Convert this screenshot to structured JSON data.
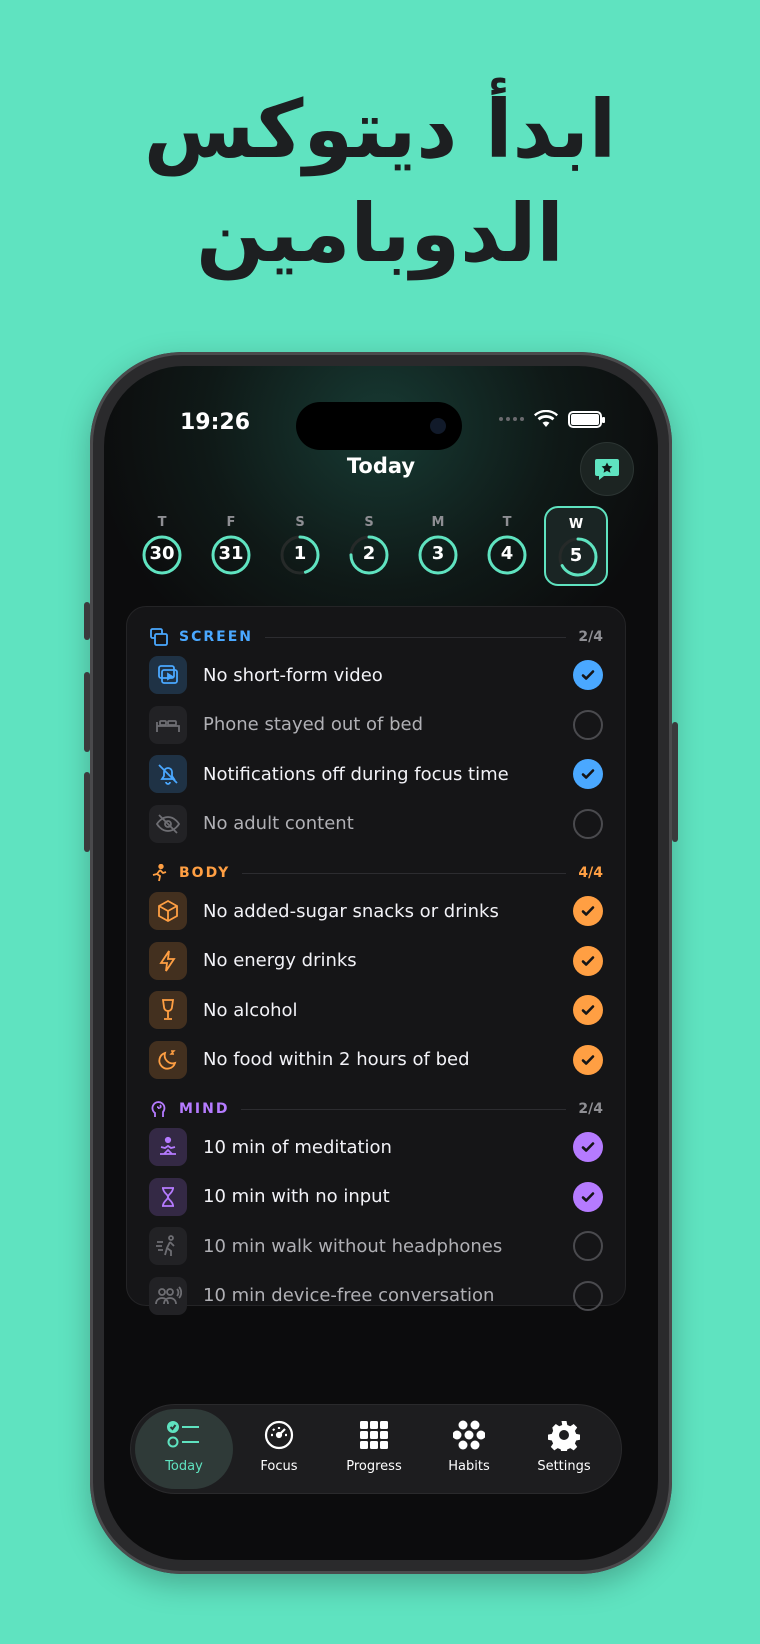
{
  "headline": {
    "line1": "ابدأ ديتوكس",
    "line2": "الدوبامين"
  },
  "status": {
    "time": "19:26"
  },
  "nav": {
    "title": "Today"
  },
  "week": [
    {
      "letter": "T",
      "num": "30",
      "progress": 1.0
    },
    {
      "letter": "F",
      "num": "31",
      "progress": 1.0
    },
    {
      "letter": "S",
      "num": "1",
      "progress": 0.45
    },
    {
      "letter": "S",
      "num": "2",
      "progress": 0.75
    },
    {
      "letter": "M",
      "num": "3",
      "progress": 1.0
    },
    {
      "letter": "T",
      "num": "4",
      "progress": 1.0
    },
    {
      "letter": "W",
      "num": "5",
      "progress": 0.67,
      "selected": true
    }
  ],
  "sections": {
    "screen": {
      "label": "SCREEN",
      "count": "2/4",
      "color": "#4aa8ff",
      "items": [
        {
          "label": "No short-form video",
          "icon": "video-icon",
          "done": true
        },
        {
          "label": "Phone stayed out of bed",
          "icon": "bed-icon",
          "done": false
        },
        {
          "label": "Notifications off during focus time",
          "icon": "bell-off-icon",
          "done": true
        },
        {
          "label": "No adult content",
          "icon": "eye-off-icon",
          "done": false
        }
      ]
    },
    "body": {
      "label": "BODY",
      "count": "4/4",
      "color": "#ff9f43",
      "items": [
        {
          "label": "No added-sugar snacks or drinks",
          "icon": "cube-icon",
          "done": true
        },
        {
          "label": "No energy drinks",
          "icon": "bolt-icon",
          "done": true
        },
        {
          "label": "No alcohol",
          "icon": "wine-glass-icon",
          "done": true
        },
        {
          "label": "No food within 2 hours of bed",
          "icon": "moon-sleep-icon",
          "done": true
        }
      ]
    },
    "mind": {
      "label": "MIND",
      "count": "2/4",
      "color": "#b57bff",
      "items": [
        {
          "label": "10 min of meditation",
          "icon": "meditation-icon",
          "done": true
        },
        {
          "label": "10 min with no input",
          "icon": "hourglass-icon",
          "done": true
        },
        {
          "label": "10 min walk without headphones",
          "icon": "walking-icon",
          "done": false
        },
        {
          "label": "10 min device-free conversation",
          "icon": "people-talk-icon",
          "done": false
        }
      ]
    }
  },
  "tabs": [
    {
      "label": "Today",
      "icon": "checklist-icon",
      "active": true
    },
    {
      "label": "Focus",
      "icon": "gauge-icon"
    },
    {
      "label": "Progress",
      "icon": "grid-icon"
    },
    {
      "label": "Habits",
      "icon": "flower-dots-icon"
    },
    {
      "label": "Settings",
      "icon": "gear-icon"
    }
  ],
  "colors": {
    "background": "#5fe3c0",
    "accent": "#5fe3c0"
  }
}
